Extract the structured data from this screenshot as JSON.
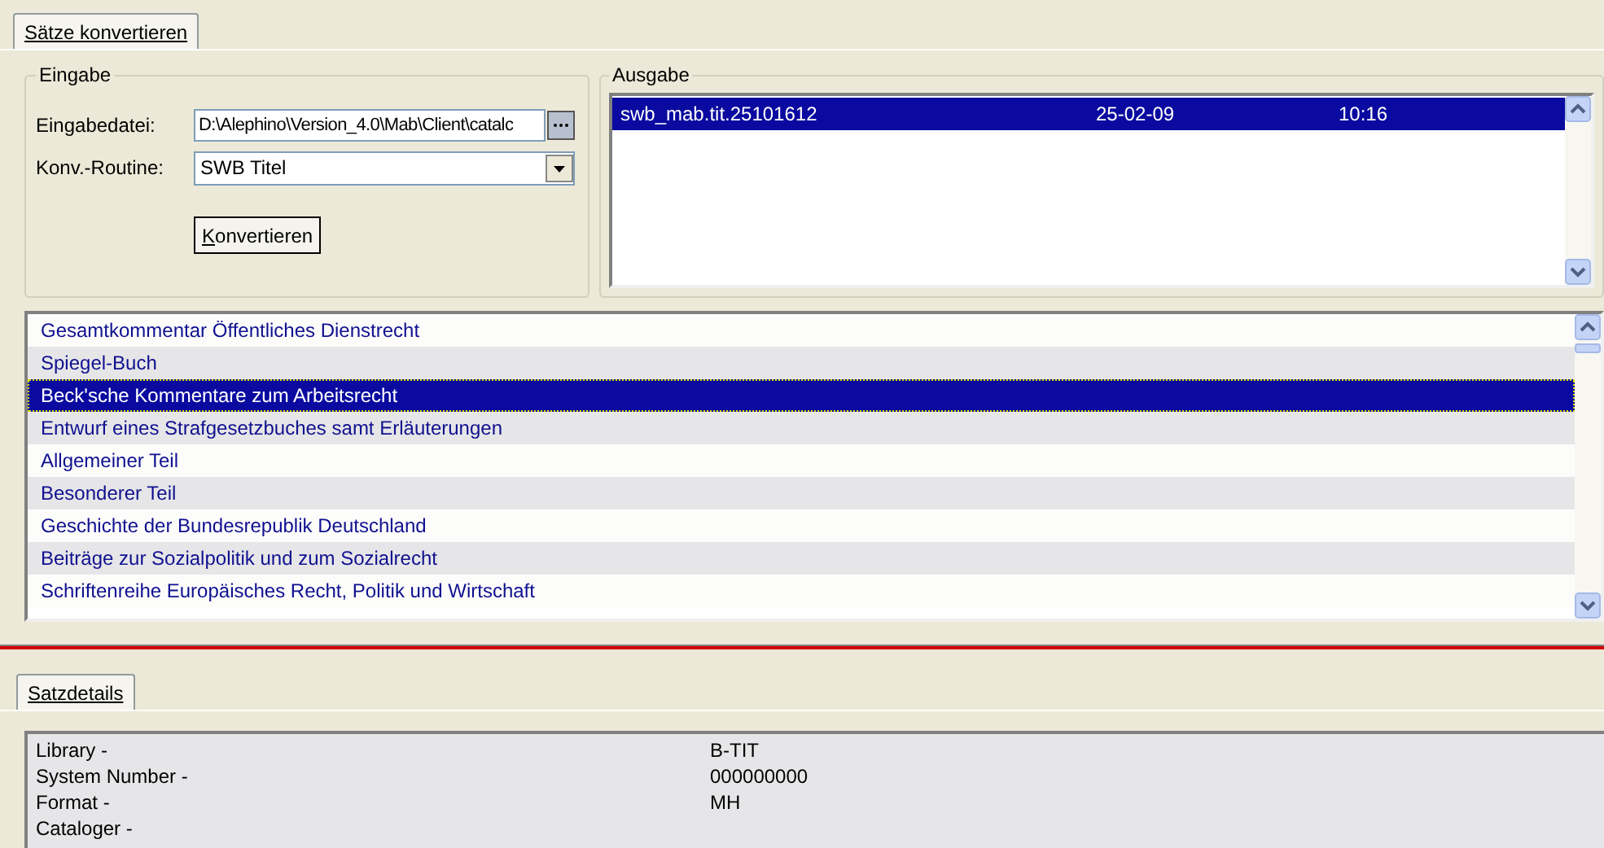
{
  "tabs": [
    {
      "label": "Sätze konvertieren",
      "selected": true
    }
  ],
  "eingabe": {
    "title": "Eingabe",
    "fields": [
      {
        "kind": "file",
        "label": "Eingabedatei:",
        "value": "D:\\Alephino\\Version_4.0\\Mab\\Client\\catalc"
      },
      {
        "kind": "select",
        "label": "Konv.-Routine:",
        "value": "SWB Titel"
      }
    ],
    "button": "Konvertieren"
  },
  "ausgabe": {
    "title": "Ausgabe",
    "rows": [
      {
        "name": "swb_mab.tit.25101612",
        "date": "25-02-09",
        "time": "10:16",
        "selected": true
      }
    ]
  },
  "titles": [
    {
      "text": "Gesamtkommentar Öffentliches Dienstrecht",
      "selected": false
    },
    {
      "text": "Spiegel-Buch",
      "selected": false
    },
    {
      "text": "Beck'sche Kommentare zum Arbeitsrecht",
      "selected": true
    },
    {
      "text": "Entwurf eines Strafgesetzbuches samt Erläuterungen",
      "selected": false
    },
    {
      "text": "Allgemeiner Teil",
      "selected": false
    },
    {
      "text": "Besonderer Teil",
      "selected": false
    },
    {
      "text": "Geschichte der Bundesrepublik Deutschland",
      "selected": false
    },
    {
      "text": "Beiträge zur Sozialpolitik und zum Sozialrecht",
      "selected": false
    },
    {
      "text": "Schriftenreihe Europäisches Recht, Politik und Wirtschaft",
      "selected": false
    }
  ],
  "details_tabs": [
    {
      "label": "Satzdetails",
      "selected": true
    }
  ],
  "details": [
    {
      "label": "Library -",
      "value": "B-TIT"
    },
    {
      "label": "System Number -",
      "value": "000000000"
    },
    {
      "label": "Format -",
      "value": "MH"
    },
    {
      "label": "Cataloger -"
    }
  ]
}
